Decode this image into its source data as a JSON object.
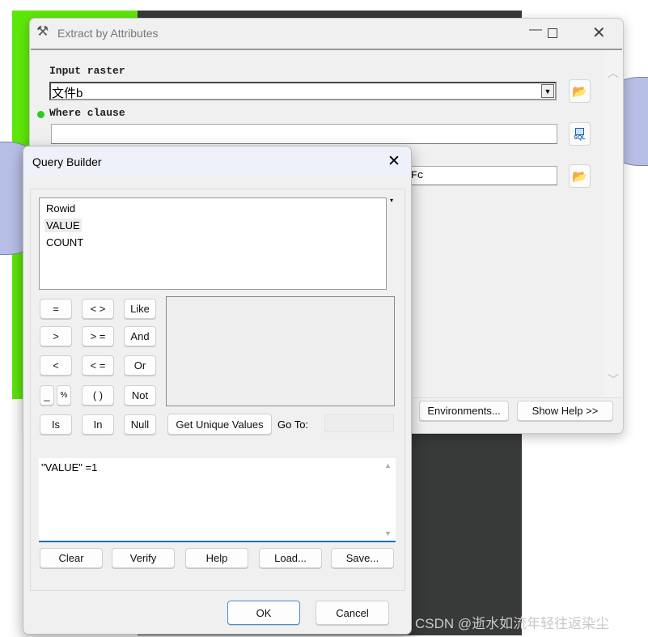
{
  "main_window": {
    "title": "Extract by Attributes",
    "input_raster_label": "Input raster",
    "input_raster_value": "文件b",
    "where_clause_label": "Where clause",
    "where_clause_value": "",
    "output_raster_value_visible": "Fc",
    "sql_icon_text": "SQL",
    "environments_label": "Environments...",
    "show_help_label": "Show Help >>",
    "required_indicator_color": "#2ecc1a"
  },
  "query_builder": {
    "title": "Query Builder",
    "fields": [
      "Rowid",
      "VALUE",
      "COUNT"
    ],
    "selected_field": "VALUE",
    "operators": [
      "=",
      "< >",
      "Like",
      ">",
      "> =",
      "And",
      "<",
      "< =",
      "Or",
      "_",
      "%",
      "( )",
      "Not",
      "Is",
      "In",
      "Null"
    ],
    "get_unique_values_label": "Get Unique Values",
    "go_to_label": "Go To:",
    "go_to_value": "",
    "expression": "\"VALUE\" =1",
    "actions": [
      "Clear",
      "Verify",
      "Help",
      "Load...",
      "Save..."
    ],
    "ok_label": "OK",
    "cancel_label": "Cancel"
  },
  "watermark": "CSDN @逝水如流年轻往返染尘"
}
